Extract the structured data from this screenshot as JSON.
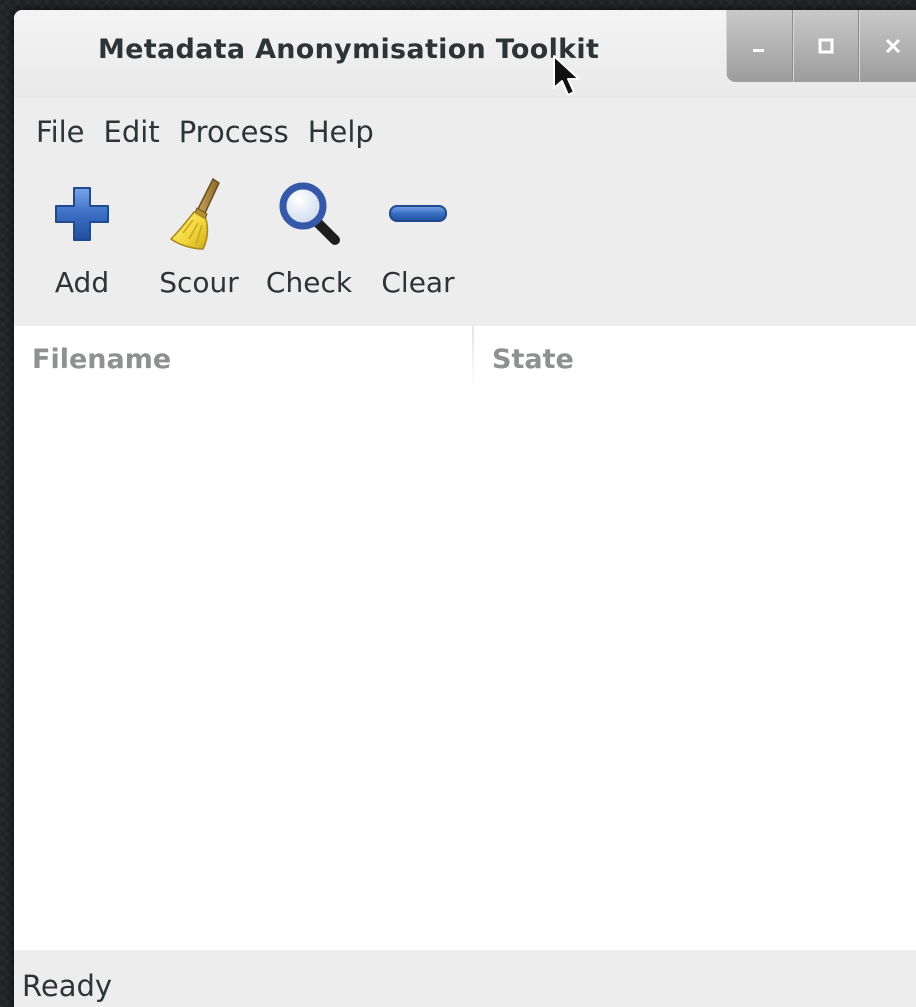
{
  "window": {
    "title": "Metadata Anonymisation Toolkit",
    "controls": [
      "minimize-icon",
      "maximize-icon",
      "close-icon"
    ]
  },
  "menubar": {
    "items": [
      {
        "label": "File"
      },
      {
        "label": "Edit"
      },
      {
        "label": "Process"
      },
      {
        "label": "Help"
      }
    ]
  },
  "toolbar": {
    "items": [
      {
        "label": "Add",
        "icon": "add-icon"
      },
      {
        "label": "Scour",
        "icon": "broom-icon"
      },
      {
        "label": "Check",
        "icon": "magnifier-icon"
      },
      {
        "label": "Clear",
        "icon": "minus-icon"
      }
    ]
  },
  "table": {
    "columns": [
      "Filename",
      "State"
    ],
    "rows": []
  },
  "statusbar": {
    "text": "Ready"
  },
  "colors": {
    "window_bg": "#ededed",
    "text": "#2e3436",
    "header_text": "#8f9090",
    "icon_blue": "#3a6fc4",
    "broom_yellow": "#f2d43a"
  }
}
